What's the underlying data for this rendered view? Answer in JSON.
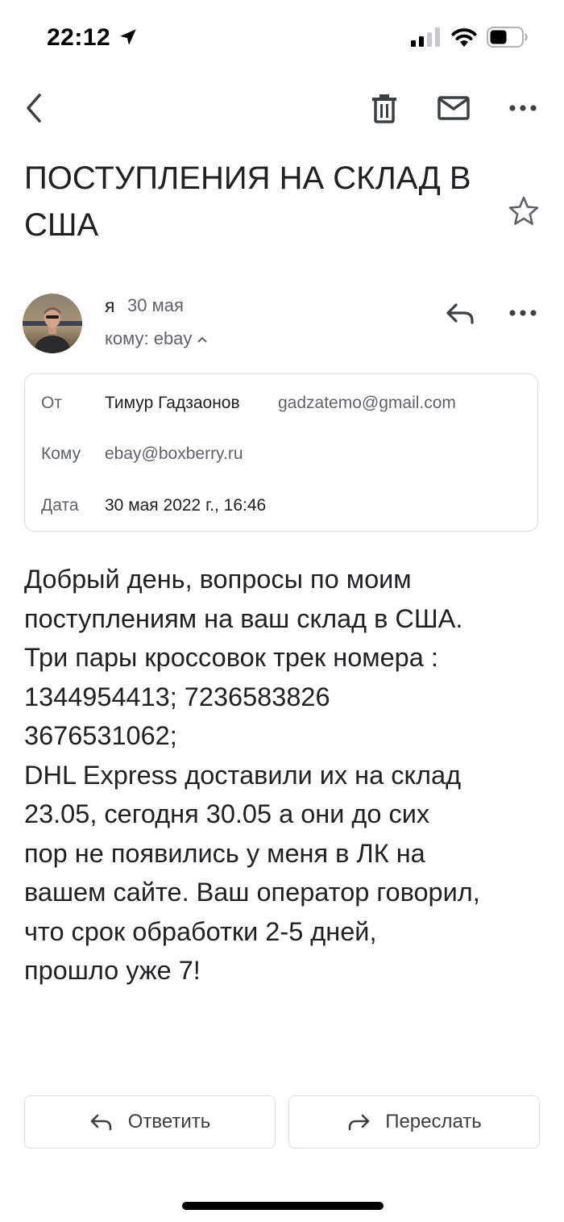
{
  "status_bar": {
    "time": "22:12"
  },
  "toolbar": {
    "icons": [
      "back-icon",
      "trash-icon",
      "mail-icon",
      "more-icon"
    ]
  },
  "subject": "ПОСТУПЛЕНИЯ НА СКЛАД В США",
  "message_header": {
    "sender": "я",
    "date": "30 мая",
    "to_line": "кому: ebay"
  },
  "details": {
    "from_label": "От",
    "from_name": "Тимур Гадзаонов",
    "from_email": "gadzatemo@gmail.com",
    "to_label": "Кому",
    "to_email": "ebay@boxberry.ru",
    "date_label": "Дата",
    "date_value": "30 мая 2022 г., 16:46"
  },
  "body": {
    "lines": [
      "Добрый день, вопросы по моим",
      "поступлениям на ваш склад в США.",
      "Три пары кроссовок трек номера :",
      "1344954413; 7236583826",
      "3676531062;",
      "DHL Express доставили их на склад",
      "23.05, сегодня 30.05 а они до сих",
      "пор не появились у меня в ЛК на",
      "вашем сайте. Ваш оператор говорил,",
      "что срок обработки 2-5 дней,",
      "прошло уже 7!"
    ]
  },
  "actions": {
    "reply_label": "Ответить",
    "forward_label": "Переслать"
  }
}
